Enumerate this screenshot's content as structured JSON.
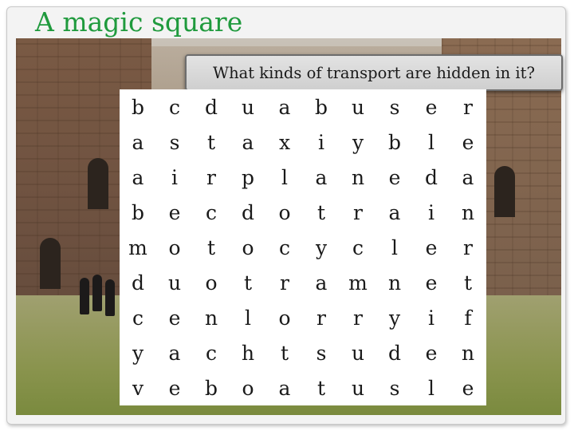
{
  "title": "A magic square",
  "question": "What kinds of transport are hidden in it?",
  "grid": [
    [
      "b",
      "c",
      "d",
      "u",
      "a",
      "b",
      "u",
      "s",
      "e",
      "r"
    ],
    [
      "a",
      "s",
      "t",
      "a",
      "x",
      "i",
      "y",
      "b",
      "l",
      "e"
    ],
    [
      "a",
      "i",
      "r",
      "p",
      "l",
      "a",
      "n",
      "e",
      "d",
      "a"
    ],
    [
      "b",
      "e",
      "c",
      "d",
      "o",
      "t",
      "r",
      "a",
      "i",
      "n"
    ],
    [
      "m",
      "o",
      "t",
      "o",
      "c",
      "y",
      "c",
      "l",
      "e",
      "r"
    ],
    [
      "d",
      "u",
      "o",
      "t",
      "r",
      "a",
      "m",
      "n",
      "e",
      "t"
    ],
    [
      "c",
      "e",
      "n",
      "l",
      "o",
      "r",
      "r",
      "y",
      "i",
      "f"
    ],
    [
      "y",
      "a",
      "c",
      "h",
      "t",
      "s",
      "u",
      "d",
      "e",
      "n"
    ],
    [
      "v",
      "e",
      "b",
      "o",
      "a",
      "t",
      "u",
      "s",
      "l",
      "e"
    ]
  ],
  "colors": {
    "title": "#1f9a3d",
    "banner": "#d9d9d9",
    "grid_background": "#ffffff"
  }
}
